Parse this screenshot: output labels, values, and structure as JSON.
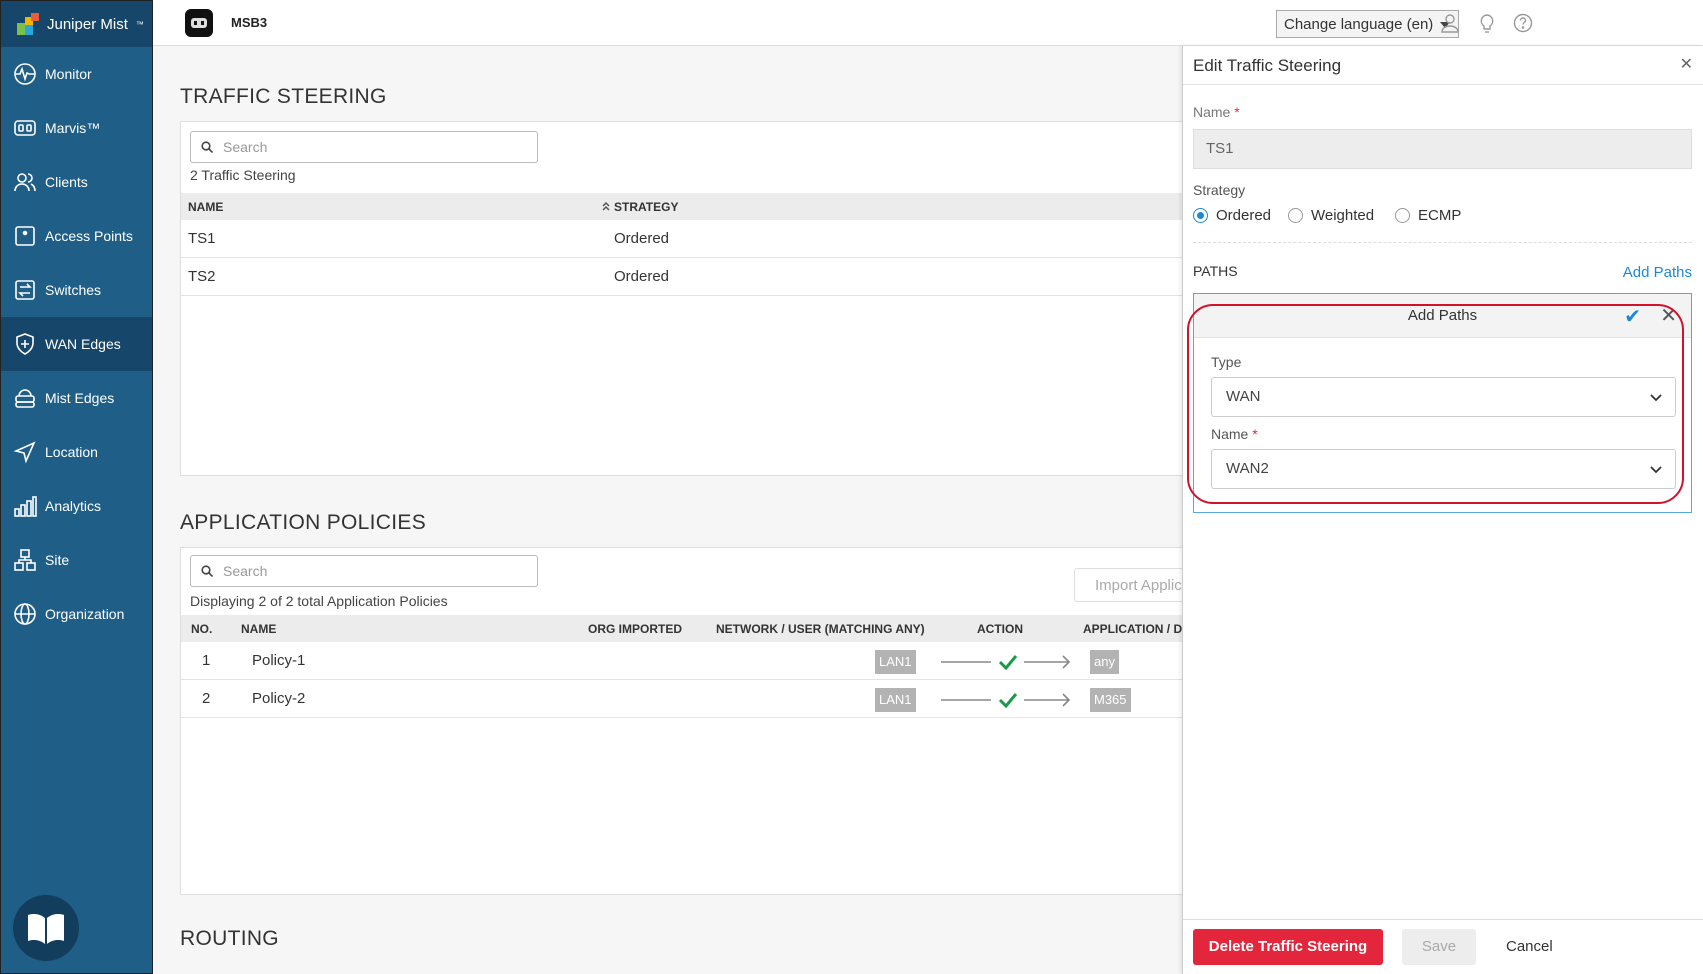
{
  "brand": {
    "name": "Juniper Mist",
    "trademark": "™"
  },
  "header": {
    "site_name": "MSB3",
    "language_label": "Change language (en)"
  },
  "sidebar": {
    "items": [
      {
        "label": "Monitor",
        "icon": "monitor-icon"
      },
      {
        "label": "Marvis™",
        "icon": "marvis-icon"
      },
      {
        "label": "Clients",
        "icon": "clients-icon"
      },
      {
        "label": "Access Points",
        "icon": "access-point-icon"
      },
      {
        "label": "Switches",
        "icon": "switch-icon"
      },
      {
        "label": "WAN Edges",
        "icon": "wan-edge-icon",
        "active": true
      },
      {
        "label": "Mist Edges",
        "icon": "mist-edge-icon"
      },
      {
        "label": "Location",
        "icon": "location-icon"
      },
      {
        "label": "Analytics",
        "icon": "analytics-icon"
      },
      {
        "label": "Site",
        "icon": "site-icon"
      },
      {
        "label": "Organization",
        "icon": "organization-icon"
      }
    ]
  },
  "traffic_steering": {
    "title": "TRAFFIC STEERING",
    "search_placeholder": "Search",
    "count_text": "2 Traffic Steering",
    "columns": {
      "name": "NAME",
      "strategy": "STRATEGY"
    },
    "rows": [
      {
        "name": "TS1",
        "strategy": "Ordered"
      },
      {
        "name": "TS2",
        "strategy": "Ordered"
      }
    ]
  },
  "application_policies": {
    "title": "APPLICATION POLICIES",
    "search_placeholder": "Search",
    "count_text": "Displaying 2 of 2 total Application Policies",
    "import_button": "Import Applica",
    "columns": {
      "no": "NO.",
      "name": "NAME",
      "org_imported": "ORG IMPORTED",
      "network": "NETWORK / USER (MATCHING ANY)",
      "action": "ACTION",
      "application": "APPLICATION / D"
    },
    "rows": [
      {
        "no": "1",
        "name": "Policy-1",
        "network": "LAN1",
        "application": "any"
      },
      {
        "no": "2",
        "name": "Policy-2",
        "network": "LAN1",
        "application": "M365"
      }
    ]
  },
  "routing": {
    "title": "ROUTING"
  },
  "drawer": {
    "title": "Edit Traffic Steering",
    "name_label": "Name",
    "name_value": "TS1",
    "strategy_label": "Strategy",
    "strategy_options": [
      "Ordered",
      "Weighted",
      "ECMP"
    ],
    "strategy_selected": "Ordered",
    "paths_label": "PATHS",
    "add_paths_link": "Add Paths",
    "add_paths": {
      "title": "Add Paths",
      "type_label": "Type",
      "type_value": "WAN",
      "name_label": "Name",
      "name_value": "WAN2"
    },
    "delete_button": "Delete Traffic Steering",
    "save_button": "Save",
    "cancel_button": "Cancel"
  },
  "colors": {
    "sidebar": "#1f5f87",
    "accent": "#1e88d8",
    "danger": "#e3263c",
    "highlight": "#d0122b"
  }
}
